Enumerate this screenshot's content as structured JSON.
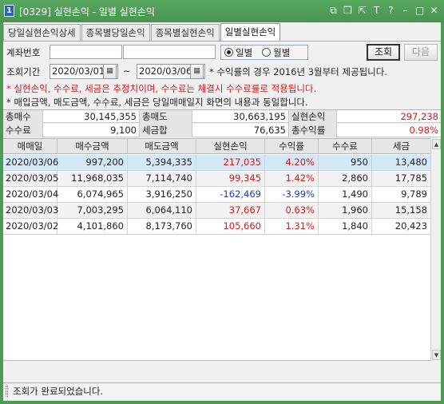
{
  "window": {
    "app_number": "1",
    "title": "[0329] 실현손익 - 일별 실현손익"
  },
  "titlebar_icons": [
    "window-icon",
    "copy-icon",
    "link-icon",
    "text-icon",
    "help-icon",
    "minimize-icon",
    "maximize-icon",
    "close-icon"
  ],
  "tabs": [
    {
      "label": "당일실현손익상세",
      "active": false
    },
    {
      "label": "종목별당일손익",
      "active": false
    },
    {
      "label": "종목별실현손익",
      "active": false
    },
    {
      "label": "일별실현손익",
      "active": true
    }
  ],
  "form": {
    "account_label": "계좌번호",
    "radio_daily": "일별",
    "radio_monthly": "월별",
    "search_button": "조회",
    "next_button": "다음",
    "period_label": "조회기간",
    "date_from": "2020/03/01",
    "date_to": "2020/03/06",
    "tilde": "~",
    "note_rate": "* 수익률의 경우 2016년 3월부터 제공됩니다.",
    "note_estimate": "* 실현손익, 수수료, 세금은 추정치이며, 수수료는 체결시 수수료률로 적용됩니다.",
    "note_same": "* 매입금액, 매도금액, 수수료, 세금은 당일매매일지 화면의 내용과 동일합니다."
  },
  "summary": {
    "row1": {
      "label_buy": "총매수",
      "total_buy": "30,145,355",
      "label_sell": "총매도",
      "total_sell": "30,663,195",
      "label_pnl": "실현손익",
      "total_pnl": "297,238"
    },
    "row2": {
      "label_fee": "수수료",
      "total_fee": "9,100",
      "label_tax": "세금합",
      "total_tax": "76,635",
      "label_rate": "총수익률",
      "total_rate": "0.98%"
    }
  },
  "table": {
    "headers": [
      "매매일",
      "매수금액",
      "매도금액",
      "실현손익",
      "수익률",
      "수수료",
      "세금"
    ],
    "rows": [
      {
        "date": "2020/03/06",
        "buy": "997,200",
        "sell": "5,394,335",
        "pnl": "217,035",
        "rate": "4.20%",
        "fee": "950",
        "tax": "13,480",
        "sign": "pos"
      },
      {
        "date": "2020/03/05",
        "buy": "11,968,035",
        "sell": "7,114,740",
        "pnl": "99,345",
        "rate": "1.42%",
        "fee": "2,860",
        "tax": "17,785",
        "sign": "pos"
      },
      {
        "date": "2020/03/04",
        "buy": "6,074,965",
        "sell": "3,916,250",
        "pnl": "-162,469",
        "rate": "-3.99%",
        "fee": "1,490",
        "tax": "9,789",
        "sign": "neg"
      },
      {
        "date": "2020/03/03",
        "buy": "7,003,295",
        "sell": "6,064,110",
        "pnl": "37,667",
        "rate": "0.63%",
        "fee": "1,960",
        "tax": "15,158",
        "sign": "pos"
      },
      {
        "date": "2020/03/02",
        "buy": "4,101,860",
        "sell": "8,173,760",
        "pnl": "105,660",
        "rate": "1.31%",
        "fee": "1,840",
        "tax": "20,423",
        "sign": "pos"
      }
    ]
  },
  "status": {
    "message": "조회가 완료되었습니다."
  },
  "colors": {
    "titlebar": "#4d9a54",
    "positive": "#d41919",
    "negative": "#1c3fb3",
    "selected_row": "#d4e8f5"
  }
}
